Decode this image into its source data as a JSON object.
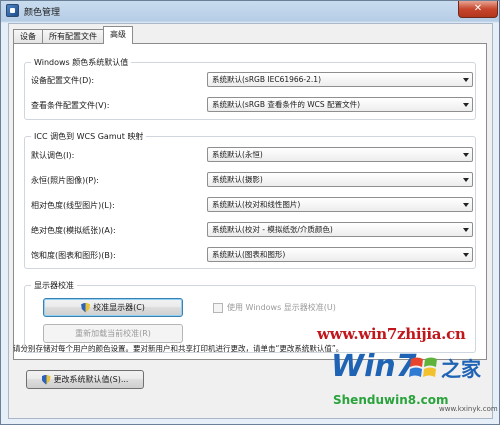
{
  "window": {
    "title": "颜色管理",
    "close_glyph": "✕"
  },
  "tabs": [
    {
      "label": "设备",
      "active": false
    },
    {
      "label": "所有配置文件",
      "active": false
    },
    {
      "label": "高级",
      "active": true
    }
  ],
  "windows_defaults": {
    "title": "Windows 颜色系统默认值",
    "rows": [
      {
        "label": "设备配置文件(D):",
        "value": "系统默认(sRGB IEC61966-2.1)"
      },
      {
        "label": "查看条件配置文件(V):",
        "value": "系统默认(sRGB 查看条件的 WCS 配置文件)"
      }
    ]
  },
  "gamut_mapping": {
    "title": "ICC 调色到 WCS Gamut 映射",
    "rows": [
      {
        "label": "默认调色(I):",
        "value": "系统默认(永恒)"
      },
      {
        "label": "永恒(照片图像)(P):",
        "value": "系统默认(摄影)"
      },
      {
        "label": "相对色度(线型图片)(L):",
        "value": "系统默认(校对和线性图片)"
      },
      {
        "label": "绝对色度(模拟纸张)(A):",
        "value": "系统默认(校对 - 模拟纸张/介质颜色)"
      },
      {
        "label": "饱和度(图表和图形)(B):",
        "value": "系统默认(图表和图形)"
      }
    ]
  },
  "calibration": {
    "title": "显示器校准",
    "calibrate_label": "校准显示器(C)",
    "reload_label": "重新加载当前校准(R)",
    "use_windows_label": "使用 Windows 显示器校准(U)"
  },
  "info_text": "请分别存储对每个用户的颜色设置。要对新用户和共享打印机进行更改，请单击“更改系统默认值”。",
  "change_defaults_label": "更改系统默认值(S)...",
  "watermark": {
    "site": "www.win7zhijia.cn",
    "logo_text": "Win7",
    "logo_suffix": "之家",
    "bottom": "Shenduwin8.com",
    "small": "www.kxinyk.com"
  },
  "colors": {
    "accent": "#3c7fb1",
    "watermark_red": "#c0161c",
    "watermark_blue": "#1f63b5",
    "watermark_green": "#2aa33c"
  }
}
